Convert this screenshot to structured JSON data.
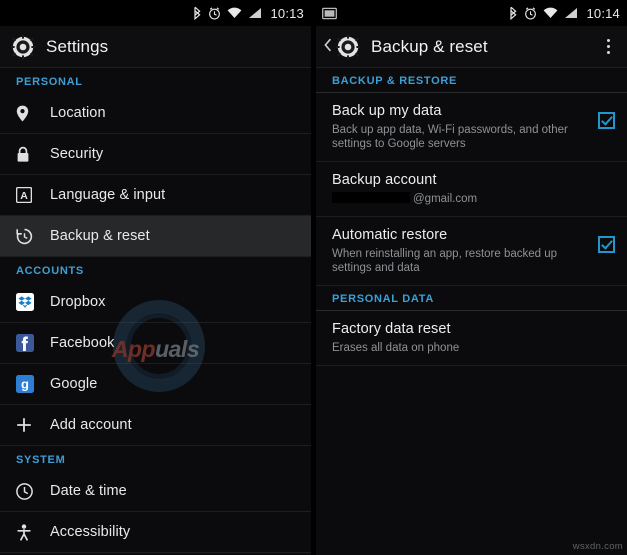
{
  "left": {
    "status_bar": {
      "icons": [
        "bluetooth-icon",
        "alarm-icon",
        "wifi-icon",
        "signal-icon"
      ],
      "clock": "10:13"
    },
    "action_bar": {
      "title": "Settings",
      "icon": "settings-gear-icon"
    },
    "sections": [
      {
        "header": "PERSONAL",
        "items": [
          {
            "label": "Location",
            "icon": "location-pin-icon"
          },
          {
            "label": "Security",
            "icon": "lock-icon"
          },
          {
            "label": "Language & input",
            "icon": "language-a-icon"
          },
          {
            "label": "Backup & reset",
            "icon": "backup-restore-icon",
            "selected": true
          }
        ]
      },
      {
        "header": "ACCOUNTS",
        "items": [
          {
            "label": "Dropbox",
            "icon": "dropbox-icon"
          },
          {
            "label": "Facebook",
            "icon": "facebook-icon"
          },
          {
            "label": "Google",
            "icon": "google-icon"
          },
          {
            "label": "Add account",
            "icon": "plus-icon"
          }
        ]
      },
      {
        "header": "SYSTEM",
        "items": [
          {
            "label": "Date & time",
            "icon": "clock-icon"
          },
          {
            "label": "Accessibility",
            "icon": "accessibility-icon"
          }
        ]
      }
    ],
    "watermark": {
      "text_part1": "App",
      "text_part2": "uals"
    }
  },
  "right": {
    "status_bar": {
      "icons": [
        "screenshot-icon",
        "bluetooth-icon",
        "alarm-icon",
        "wifi-icon",
        "signal-icon"
      ],
      "clock": "10:14"
    },
    "action_bar": {
      "title": "Backup & reset",
      "icon": "settings-gear-icon",
      "back": "back-chevron-icon",
      "overflow": "overflow-menu-icon"
    },
    "sections": [
      {
        "header": "BACKUP & RESTORE",
        "items": [
          {
            "title": "Back up my data",
            "sub": "Back up app data, Wi-Fi passwords, and other settings to Google servers",
            "checked": true
          },
          {
            "title": "Backup account",
            "sub": "@gmail.com",
            "masked": true,
            "checked": false
          },
          {
            "title": "Automatic restore",
            "sub": "When reinstalling an app, restore backed up settings and data",
            "checked": true
          }
        ]
      },
      {
        "header": "PERSONAL DATA",
        "items": [
          {
            "title": "Factory data reset",
            "sub": "Erases all data on phone",
            "checked": false
          }
        ]
      }
    ],
    "corner_watermark": "wsxdn.com"
  },
  "colors": {
    "accent": "#3c9fd6",
    "checkbox": "#2196cf",
    "background": "#0b0b0d",
    "selected_row": "#26282a"
  }
}
